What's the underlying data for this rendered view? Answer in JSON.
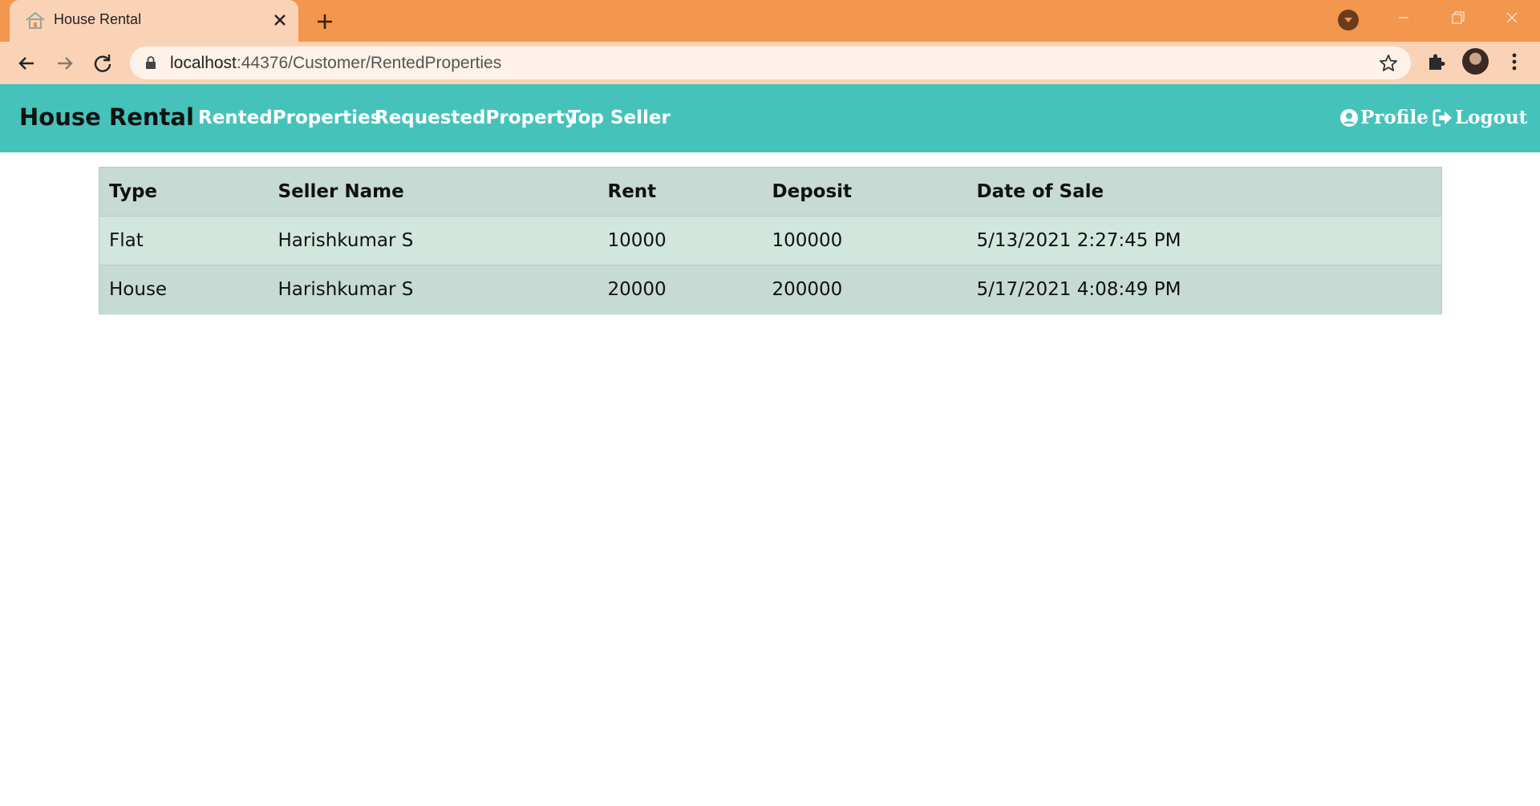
{
  "browser": {
    "tab_title": "House Rental",
    "url_host": "localhost",
    "url_rest": ":44376/Customer/RentedProperties",
    "colors": {
      "tabstrip": "#f3964e",
      "toolbar": "#fad3b6",
      "omnibox": "#fef2ea"
    }
  },
  "navbar": {
    "brand": "House Rental",
    "links": [
      "RentedProperties",
      "RequestedProperty",
      "Top Seller"
    ],
    "profile": "Profile",
    "logout": "Logout",
    "color": "#45c3bb"
  },
  "table": {
    "headers": [
      "Type",
      "Seller Name",
      "Rent",
      "Deposit",
      "Date of Sale"
    ],
    "rows": [
      [
        "Flat",
        "Harishkumar S",
        "10000",
        "100000",
        "5/13/2021 2:27:45 PM"
      ],
      [
        "House",
        "Harishkumar S",
        "20000",
        "200000",
        "5/17/2021 4:08:49 PM"
      ]
    ]
  },
  "icons": [
    "house-favicon-icon",
    "close-icon",
    "plus-icon",
    "tab-search-icon",
    "minimize-icon",
    "maximize-icon",
    "window-close-icon",
    "back-arrow-icon",
    "forward-arrow-icon",
    "reload-icon",
    "lock-icon",
    "star-icon",
    "puzzle-icon",
    "kebab-menu-icon",
    "user-circle-icon",
    "sign-out-icon"
  ]
}
